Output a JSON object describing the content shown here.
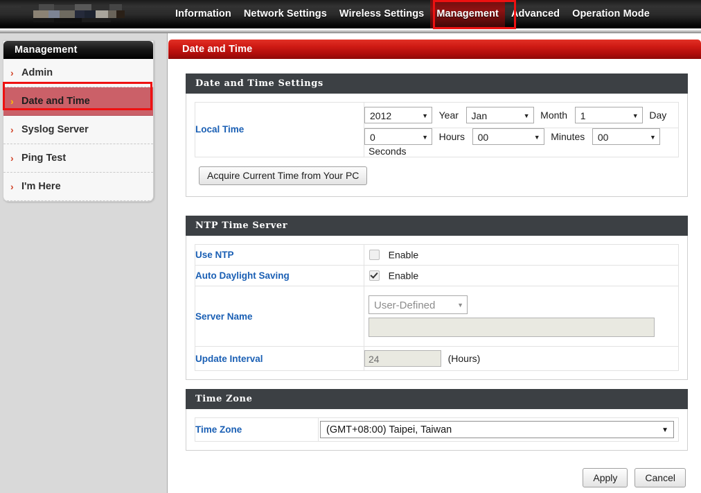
{
  "nav": {
    "logo": "redacted-logo",
    "items": [
      {
        "label": "Information",
        "active": false
      },
      {
        "label": "Network Settings",
        "active": false
      },
      {
        "label": "Wireless Settings",
        "active": false
      },
      {
        "label": "Management",
        "active": true
      },
      {
        "label": "Advanced",
        "active": false
      },
      {
        "label": "Operation Mode",
        "active": false
      }
    ]
  },
  "sidebar": {
    "title": "Management",
    "items": [
      {
        "label": "Admin",
        "selected": false
      },
      {
        "label": "Date and Time",
        "selected": true
      },
      {
        "label": "Syslog Server",
        "selected": false
      },
      {
        "label": "Ping Test",
        "selected": false
      },
      {
        "label": "I'm Here",
        "selected": false
      }
    ]
  },
  "page": {
    "title": "Date and Time"
  },
  "datetime_settings": {
    "title": "Date and Time Settings",
    "local_time_label": "Local Time",
    "year": "2012",
    "year_unit": "Year",
    "month": "Jan",
    "month_unit": "Month",
    "day": "1",
    "day_unit": "Day",
    "hours": "0",
    "hours_unit": "Hours",
    "minutes": "00",
    "minutes_unit": "Minutes",
    "seconds": "00",
    "seconds_unit": "Seconds",
    "acquire_button": "Acquire Current Time from Your PC"
  },
  "ntp": {
    "title": "NTP Time Server",
    "use_ntp_label": "Use NTP",
    "use_ntp_enable_label": "Enable",
    "use_ntp_checked": false,
    "dst_label": "Auto Daylight Saving",
    "dst_enable_label": "Enable",
    "dst_checked": true,
    "server_name_label": "Server Name",
    "server_name_select": "User-Defined",
    "server_name_value": "",
    "update_interval_label": "Update Interval",
    "update_interval_value": "24",
    "update_interval_unit": "(Hours)"
  },
  "timezone": {
    "title": "Time Zone",
    "label": "Time Zone",
    "value": "(GMT+08:00) Taipei, Taiwan"
  },
  "footer": {
    "apply": "Apply",
    "cancel": "Cancel"
  },
  "icons": {
    "chevron_right": "›",
    "caret_down": "▼"
  },
  "colors": {
    "brand_red": "#cf1a14",
    "nav_active_red": "#8e1212",
    "annotation_red": "#ee1111",
    "panel_head": "#3c4044",
    "label_blue": "#1a5fb4",
    "selected_item": "#cb6068",
    "chevron_orange": "#d2452a",
    "chevron_selected": "#ffc000"
  }
}
